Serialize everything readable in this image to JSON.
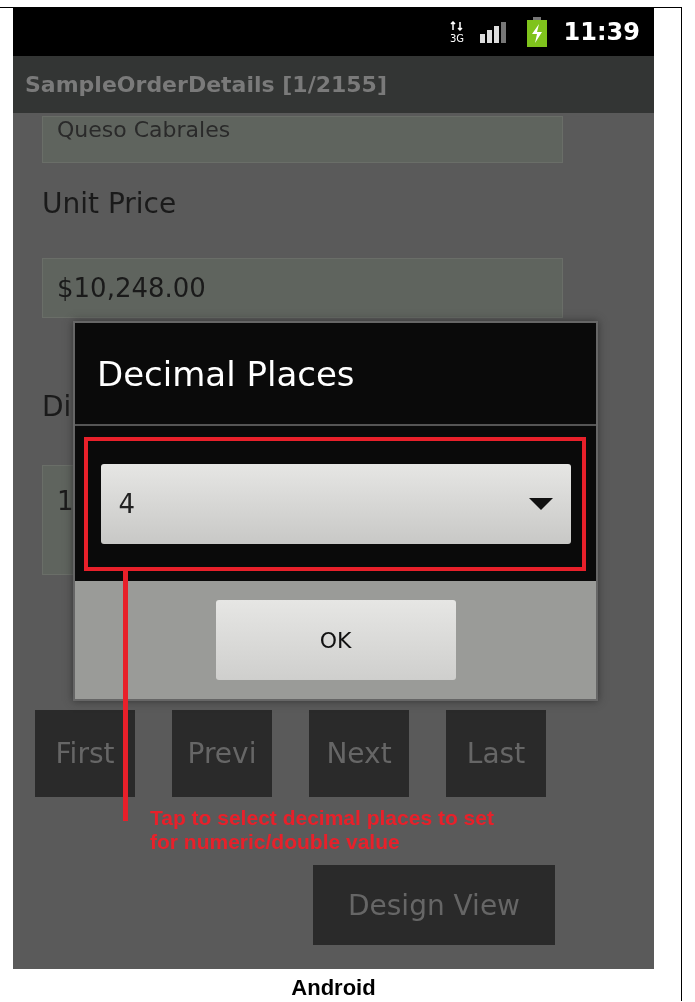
{
  "status_bar": {
    "network": "3G",
    "time": "11:39"
  },
  "title_bar": {
    "title": "SampleOrderDetails [1/2155]"
  },
  "form_items": [
    {
      "kind": "field",
      "value": "Queso Cabrales"
    },
    {
      "kind": "label",
      "text": "Unit Price"
    },
    {
      "kind": "field",
      "value": "$10,248.00"
    },
    {
      "kind": "label",
      "text": "Di"
    },
    {
      "kind": "field",
      "value": "1"
    }
  ],
  "nav_buttons": [
    "First",
    "Previ",
    "Next",
    "Last"
  ],
  "design_button": "Design View",
  "dialog": {
    "title": "Decimal Places",
    "spinner": {
      "value": "4"
    },
    "buttons": [
      "OK"
    ]
  },
  "annotation": {
    "text": "Tap to select decimal places to set\nfor numeric/double value"
  },
  "caption": "Android"
}
